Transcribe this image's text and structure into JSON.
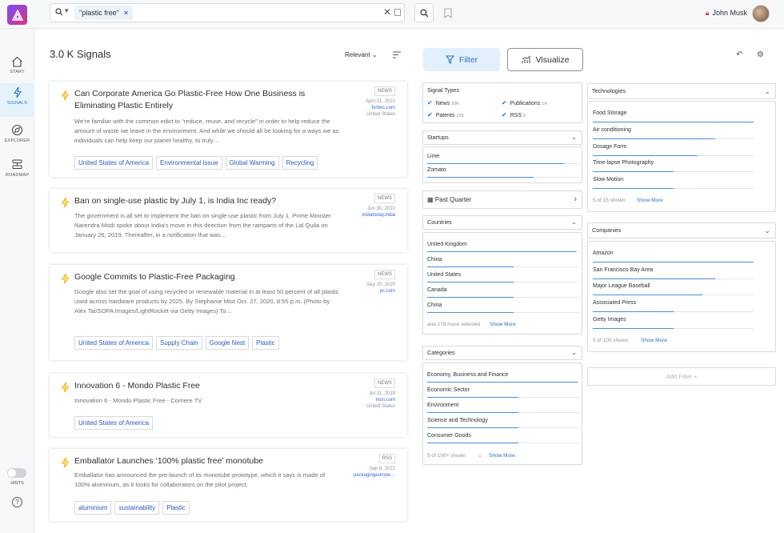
{
  "search": {
    "chip": "\"plastic free\""
  },
  "user": {
    "name": "John Musk"
  },
  "nav": [
    {
      "label": "START",
      "icon": "home-icon"
    },
    {
      "label": "SIGNALS",
      "icon": "bolt-icon"
    },
    {
      "label": "EXPLORER",
      "icon": "compass-icon"
    },
    {
      "label": "ROADMAP",
      "icon": "roadmap-icon"
    }
  ],
  "hints_label": "HINTS",
  "signals_count": "3.0 K Signals",
  "sort_label": "Relevant",
  "cards": [
    {
      "title": "Can Corporate America Go Plastic-Free How One Business is Eliminating Plastic Entirely",
      "body": "We're familiar with the common edict to “reduce, reuse, and recycle” in order to help reduce the amount of waste we leave in the environment. And while we should all be looking for a ways we as individuals can help keep our planet healthy, to truly…",
      "source": "NEWS",
      "date": "April 21, 2021",
      "site": "forbes.com",
      "location": "United States",
      "tags": [
        "United States of America",
        "Environmental Issue",
        "Global Warming",
        "Recycling"
      ]
    },
    {
      "title": "Ban on single-use plastic by July 1, is India Inc ready?",
      "body": "The government is all set to implement the ban on single-use plastic from July 1. Prime Minister Narendra Modi spoke about India's move in this direction from the ramparts of the Lal Quila on January 26, 2019. Thereafter, in a notification that was…",
      "source": "NEWS",
      "date": "Jun 30, 2022",
      "site": "indiatoday.india",
      "location": "",
      "tags": []
    },
    {
      "title": "Google Commits to Plastic-Free Packaging",
      "body": "Google also set the goal of using recycled or renewable material in at least 50 percent of all plastic used across hardware products by 2025. By Stephanie Miot Oct. 27, 2020, 8:55 p.m. (Photo by Alex Tai/SOPA Images/LightRocket via Getty Images) To…",
      "source": "NEWS",
      "date": "Sep 20, 2020",
      "site": "pc.com",
      "location": "",
      "tags": [
        "United States of America",
        "Supply Chain",
        "Google Nest",
        "Plastic"
      ]
    },
    {
      "title": "Innovation 6 - Mondo Plastic Free",
      "body": "Innovation 6 - Mondo Plastic Free - Corriere TV",
      "source": "NEWS",
      "date": "Jul 31, 2019",
      "site": "msn.com",
      "location": "United States",
      "tags": [
        "United States of America"
      ]
    },
    {
      "title": "Emballator Launches ‘100% plastic free’ monotube",
      "body": "Emballator has announced the pre-launch of its monotube prototype, which it says is made of 100% aluminium, as it looks for collaborators on the pilot project.",
      "source": "RSS",
      "date": "Sep 8, 2021",
      "site": "packagingeurope…",
      "location": "",
      "tags": [
        "aluminium",
        "sustainability",
        "Plastic"
      ]
    }
  ],
  "filter_btn": "Filter",
  "visualize_btn": "Visualize",
  "signal_types": {
    "title": "Signal Types",
    "items": [
      {
        "label": "News",
        "count": "30K"
      },
      {
        "label": "Publications",
        "count": "1K"
      },
      {
        "label": "Patents",
        "count": "220"
      },
      {
        "label": "RSS",
        "count": "5"
      }
    ]
  },
  "startups": {
    "title": "Startups",
    "items": [
      {
        "label": "Lime",
        "fill": 0.9
      },
      {
        "label": "Zomato",
        "fill": 0.7
      }
    ]
  },
  "date_filter": "Past Quarter",
  "countries": {
    "title": "Countries",
    "items": [
      {
        "label": "United Kingdom",
        "fill": 0.98
      },
      {
        "label": "China",
        "fill": 0.57
      },
      {
        "label": "United States",
        "fill": 0.57
      },
      {
        "label": "Canada",
        "fill": 0.57
      },
      {
        "label": "China",
        "fill": 0.57
      }
    ],
    "footer": "and 178 more selected",
    "show_more": "Show More"
  },
  "categories": {
    "title": "Categories",
    "items": [
      {
        "label": "Economy, Business and Finance",
        "fill": 0.99
      },
      {
        "label": "Economic Sector",
        "fill": 0.6
      },
      {
        "label": "Environment",
        "fill": 0.6
      },
      {
        "label": "Science and Technology",
        "fill": 0.6
      },
      {
        "label": "Consumer Goods",
        "fill": 0.6
      }
    ],
    "footer": "5 of 100+ shown",
    "show_more": "Show More"
  },
  "technologies": {
    "title": "Technologies",
    "items": [
      {
        "label": "Food Storage",
        "fill": 1.0
      },
      {
        "label": "Air conditioning",
        "fill": 0.76
      },
      {
        "label": "Dosage Form",
        "fill": 0.65
      },
      {
        "label": "Time-lapse Photography",
        "fill": 0.5
      },
      {
        "label": "Slow Motion",
        "fill": 0.5
      }
    ],
    "footer": "5 of 15 shown",
    "show_more": "Show More"
  },
  "companies": {
    "title": "Companies",
    "items": [
      {
        "label": "Amazon",
        "fill": 1.0
      },
      {
        "label": "San Francisco Bay Area",
        "fill": 0.76
      },
      {
        "label": "Major League Baseball",
        "fill": 0.68
      },
      {
        "label": "Associated Press",
        "fill": 0.5
      },
      {
        "label": "Getty Images",
        "fill": 0.5
      }
    ],
    "footer": "5 of 100 shown",
    "show_more": "Show More"
  },
  "add_filter": "Add Filter +",
  "accent_color": "#2b73c4",
  "bar_color": "#4a90d9"
}
